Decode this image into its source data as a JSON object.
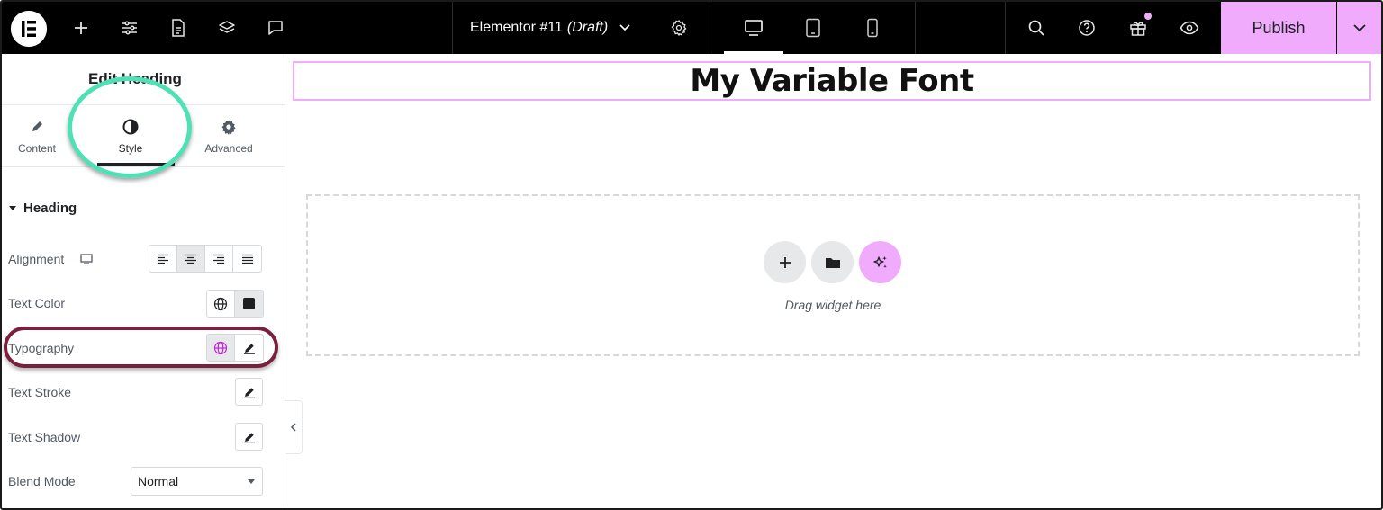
{
  "topbar": {
    "document_name": "Elementor #11",
    "document_status": "(Draft)",
    "publish_label": "Publish"
  },
  "panel": {
    "title": "Edit Heading",
    "tabs": [
      {
        "label": "Content"
      },
      {
        "label": "Style"
      },
      {
        "label": "Advanced"
      }
    ],
    "active_tab": "Style",
    "section": {
      "title": "Heading",
      "controls": {
        "alignment": "Alignment",
        "text_color": "Text Color",
        "typography": "Typography",
        "text_stroke": "Text Stroke",
        "text_shadow": "Text Shadow",
        "blend_mode": "Blend Mode"
      },
      "blend_mode_value": "Normal",
      "alignment_selected": "center"
    }
  },
  "canvas": {
    "heading": "My Variable Font",
    "dropzone_text": "Drag widget here"
  },
  "colors": {
    "accent": "#f0abfc",
    "highlight_green": "#4fe0b6",
    "highlight_maroon": "#7a1f3d",
    "topbar": "#000000"
  }
}
